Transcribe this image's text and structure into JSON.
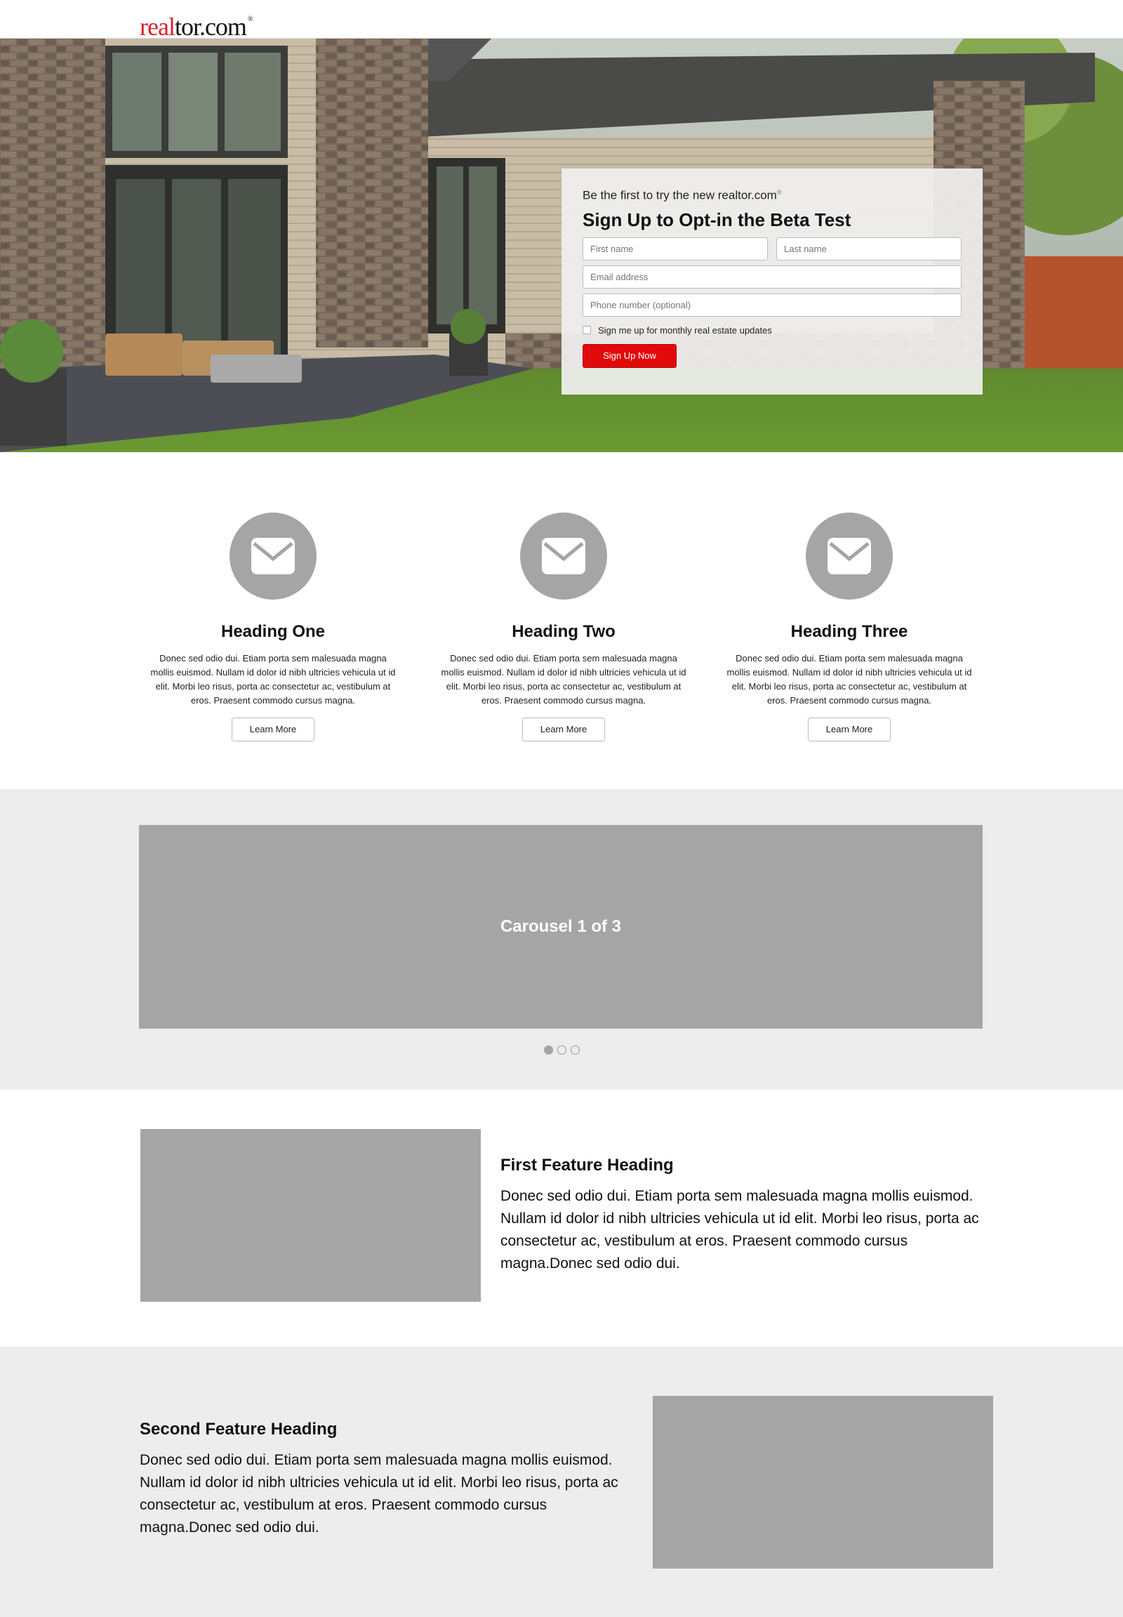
{
  "header": {
    "logo_real": "real",
    "logo_tor": "tor.com",
    "logo_mark": "®"
  },
  "signup": {
    "kicker": "Be the first to try the new realtor.com",
    "kicker_mark": "®",
    "title": "Sign Up to Opt-in the Beta Test",
    "first_name_placeholder": "First name",
    "last_name_placeholder": "Last name",
    "email_placeholder": "Email address",
    "phone_placeholder": "Phone number (optional)",
    "checkbox_label": "Sign me up for monthly real estate updates",
    "submit_label": "Sign Up Now",
    "accent_color": "#e00a0a"
  },
  "columns": [
    {
      "icon": "envelope-icon",
      "heading": "Heading One",
      "body": "Donec sed odio dui. Etiam porta sem malesuada magna mollis euismod. Nullam id dolor id nibh ultricies vehicula ut id elit. Morbi leo risus, porta ac consectetur ac, vestibulum at eros. Praesent commodo cursus magna.",
      "button": "Learn More"
    },
    {
      "icon": "envelope-icon",
      "heading": "Heading Two",
      "body": "Donec sed odio dui. Etiam porta sem malesuada magna mollis euismod. Nullam id dolor id nibh ultricies vehicula ut id elit. Morbi leo risus, porta ac consectetur ac, vestibulum at eros. Praesent commodo cursus magna.",
      "button": "Learn More"
    },
    {
      "icon": "envelope-icon",
      "heading": "Heading Three",
      "body": "Donec sed odio dui. Etiam porta sem malesuada magna mollis euismod. Nullam id dolor id nibh ultricies vehicula ut id elit. Morbi leo risus, porta ac consectetur ac, vestibulum at eros. Praesent commodo cursus magna.",
      "button": "Learn More"
    }
  ],
  "carousel": {
    "label": "Carousel 1 of 3",
    "active_index": 0,
    "slide_count": 3
  },
  "feature_one": {
    "heading": "First Feature Heading",
    "body": "Donec sed odio dui. Etiam porta sem malesuada magna mollis euismod. Nullam id dolor id nibh ultricies vehicula ut id elit. Morbi leo risus, porta ac consectetur ac, vestibulum at eros. Praesent commodo cursus magna.Donec sed odio dui."
  },
  "feature_two": {
    "heading": "Second Feature Heading",
    "body": "Donec sed odio dui. Etiam porta sem malesuada magna mollis euismod. Nullam id dolor id nibh ultricies vehicula ut id elit. Morbi leo risus, porta ac consectetur ac, vestibulum at eros. Praesent commodo cursus magna.Donec sed odio dui."
  }
}
